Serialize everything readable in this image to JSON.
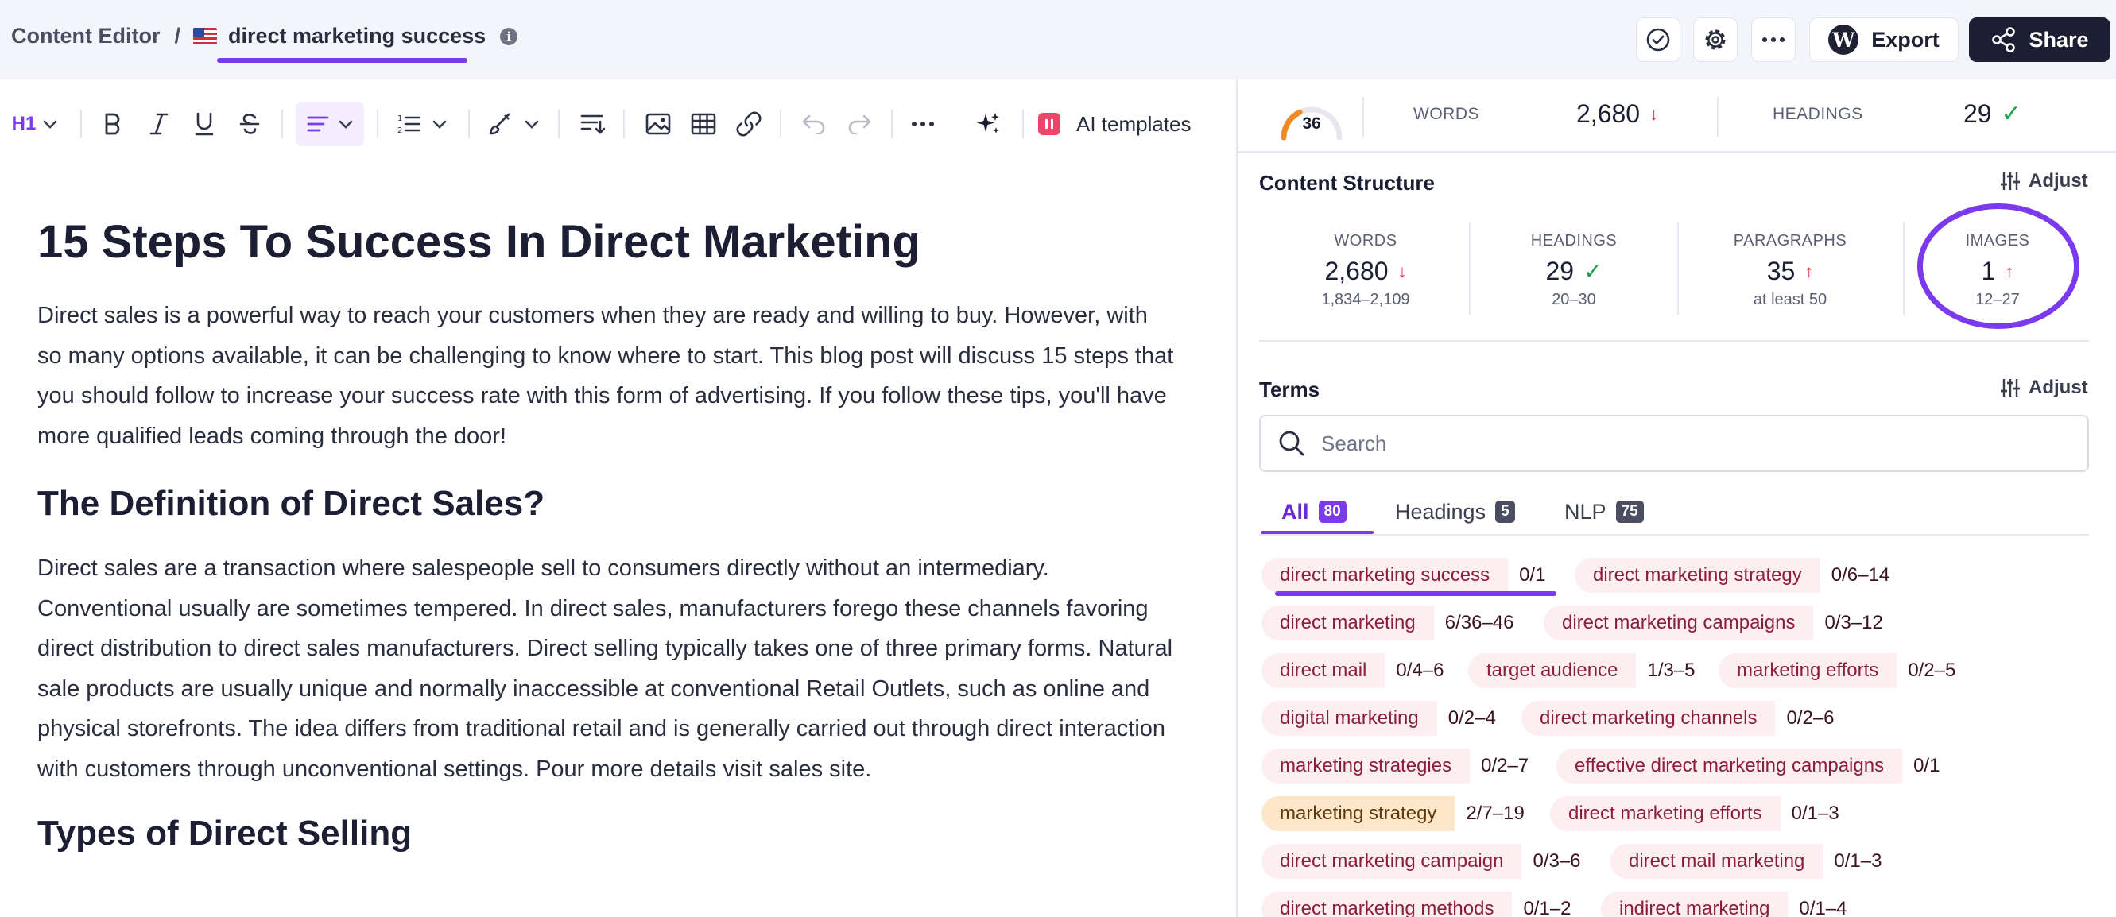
{
  "breadcrumb": {
    "root": "Content Editor",
    "separator": "/",
    "title": "direct marketing success"
  },
  "header": {
    "export_label": "Export",
    "share_label": "Share"
  },
  "toolbar": {
    "heading_label": "H1",
    "ai_templates_label": "AI templates"
  },
  "document": {
    "title": "15 Steps To Success In Direct Marketing",
    "intro": "Direct sales is a powerful way to reach your customers when they are ready and willing to buy. However, with so many options available, it can be challenging to know where to start. This blog post will discuss 15 steps that you should follow to increase your success rate with this form of advertising. If you follow these tips, you'll have more qualified leads coming through the door!",
    "h2_definition": "The Definition of Direct Sales?",
    "definition_text": "Direct sales are a transaction where salespeople sell to consumers directly without an intermediary. Conventional usually are sometimes tempered. In direct sales, manufacturers forego these channels favoring direct distribution to direct sales manufacturers. Direct selling typically takes one of three primary forms. Natural sale products are usually unique and normally inaccessible at conventional Retail Outlets, such as online and physical storefronts. The idea differs from traditional retail and is generally carried out through direct interaction with customers through unconventional settings. Pour more details visit sales site.",
    "h2_types": "Types of Direct Selling"
  },
  "summary": {
    "score": "36",
    "score_fraction": 0.36,
    "words_label": "WORDS",
    "words_value": "2,680",
    "headings_label": "HEADINGS",
    "headings_value": "29"
  },
  "content_structure": {
    "title": "Content Structure",
    "adjust_label": "Adjust",
    "metrics": [
      {
        "label": "WORDS",
        "value": "2,680",
        "range": "1,834–2,109",
        "status": "down"
      },
      {
        "label": "HEADINGS",
        "value": "29",
        "range": "20–30",
        "status": "ok"
      },
      {
        "label": "PARAGRAPHS",
        "value": "35",
        "range": "at least 50",
        "status": "up"
      },
      {
        "label": "IMAGES",
        "value": "1",
        "range": "12–27",
        "status": "up"
      }
    ]
  },
  "terms": {
    "title": "Terms",
    "adjust_label": "Adjust",
    "search_placeholder": "Search",
    "tabs": [
      {
        "label": "All",
        "count": "80"
      },
      {
        "label": "Headings",
        "count": "5"
      },
      {
        "label": "NLP",
        "count": "75"
      }
    ],
    "items": [
      {
        "name": "direct marketing success",
        "count": "0/1"
      },
      {
        "name": "direct marketing strategy",
        "count": "0/6–14"
      },
      {
        "name": "direct marketing",
        "count": "6/36–46"
      },
      {
        "name": "direct marketing campaigns",
        "count": "0/3–12"
      },
      {
        "name": "direct mail",
        "count": "0/4–6"
      },
      {
        "name": "target audience",
        "count": "1/3–5"
      },
      {
        "name": "marketing efforts",
        "count": "0/2–5"
      },
      {
        "name": "digital marketing",
        "count": "0/2–4"
      },
      {
        "name": "direct marketing channels",
        "count": "0/2–6"
      },
      {
        "name": "marketing strategies",
        "count": "0/2–7"
      },
      {
        "name": "effective direct marketing campaigns",
        "count": "0/1"
      },
      {
        "name": "marketing strategy",
        "count": "2/7–19"
      },
      {
        "name": "direct marketing efforts",
        "count": "0/1–3"
      },
      {
        "name": "direct marketing campaign",
        "count": "0/3–6"
      },
      {
        "name": "direct mail marketing",
        "count": "0/1–3"
      },
      {
        "name": "direct marketing methods",
        "count": "0/1–2"
      },
      {
        "name": "indirect marketing",
        "count": "0/1–4"
      }
    ]
  },
  "colors": {
    "accent": "#7c3aed",
    "term_bg": "#fdeef1",
    "term_highlight_bg": "#fde7c8",
    "warning_arrow": "#e02d3c",
    "ok_check": "#15a34a",
    "gauge": "#f08a24"
  },
  "icons": [
    "flag-us-icon",
    "info-icon",
    "check-circle-icon",
    "gear-icon",
    "more-icon",
    "wordpress-icon",
    "share-icon",
    "chevron-down-icon",
    "bold-icon",
    "italic-icon",
    "underline-icon",
    "strikethrough-icon",
    "align-icon",
    "list-icon",
    "brush-icon",
    "sort-icon",
    "image-icon",
    "table-icon",
    "link-icon",
    "undo-icon",
    "redo-icon",
    "sparkle-icon",
    "sliders-icon",
    "search-icon",
    "arrow-down-icon",
    "arrow-up-icon"
  ]
}
